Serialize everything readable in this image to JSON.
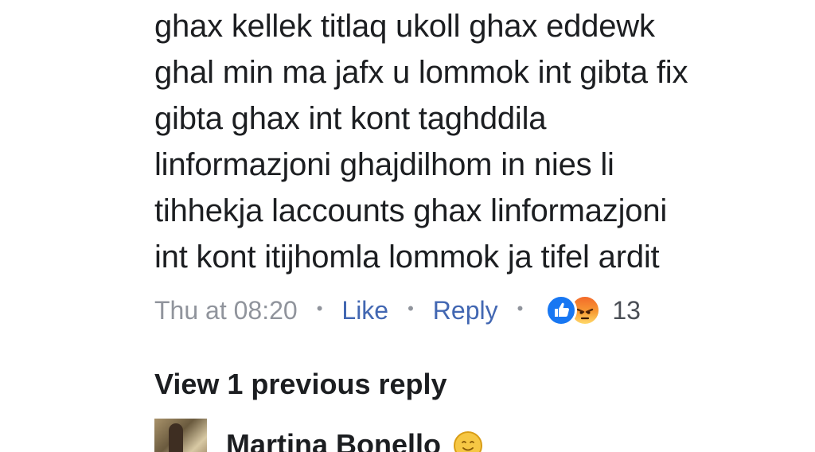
{
  "comment": {
    "lines": [
      "ghax kellek titlaq ukoll ghax eddewk",
      "ghal min ma jafx u lommok int gibta fix",
      "gibta ghax int kont taghddila",
      "linformazjoni ghajdilhom in nies li",
      "tihhekja laccounts ghax linformazjoni",
      "int kont itijhomla lommok ja tifel ardit"
    ]
  },
  "actions": {
    "timestamp": "Thu at 08:20",
    "separator": "•",
    "like_label": "Like",
    "reply_label": "Reply",
    "reaction_icons": [
      "like-reaction",
      "angry-reaction"
    ],
    "reaction_count": "13"
  },
  "replies": {
    "view_previous_label": "View 1 previous reply",
    "reply_author": "Martina Bonello",
    "author_emoji": "smiling-face"
  },
  "colors": {
    "link": "#4267b2",
    "muted": "#90949c",
    "like_blue": "#1877f2",
    "angry_orange": "#f36a2a"
  }
}
